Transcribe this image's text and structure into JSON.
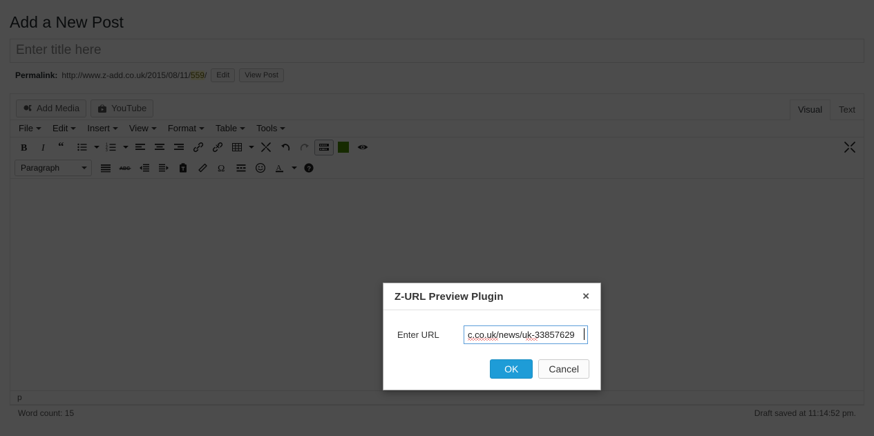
{
  "page": {
    "title": "Add a New Post"
  },
  "post_title": {
    "placeholder": "Enter title here",
    "value": ""
  },
  "permalink": {
    "label": "Permalink:",
    "url_prefix": "http://www.z-add.co.uk/2015/08/11/",
    "slug": "559",
    "url_suffix": "/",
    "edit_label": "Edit",
    "view_label": "View Post"
  },
  "media_bar": {
    "add_media_label": "Add Media",
    "youtube_label": "YouTube",
    "tabs": [
      {
        "label": "Visual",
        "active": true
      },
      {
        "label": "Text",
        "active": false
      }
    ]
  },
  "menubar": {
    "items": [
      {
        "label": "File"
      },
      {
        "label": "Edit"
      },
      {
        "label": "Insert"
      },
      {
        "label": "View"
      },
      {
        "label": "Format"
      },
      {
        "label": "Table"
      },
      {
        "label": "Tools"
      }
    ]
  },
  "toolbar_row1": {
    "buttons": [
      {
        "name": "bold",
        "glyph": "B"
      },
      {
        "name": "italic",
        "glyph": "I"
      },
      {
        "name": "blockquote",
        "glyph": "“"
      },
      {
        "name": "bullet-list",
        "glyph": "list"
      },
      {
        "name": "numbered-list",
        "glyph": "numlist"
      },
      {
        "name": "align-left",
        "glyph": "alignleft"
      },
      {
        "name": "align-center",
        "glyph": "aligncenter"
      },
      {
        "name": "align-right",
        "glyph": "alignright"
      },
      {
        "name": "link",
        "glyph": "link"
      },
      {
        "name": "unlink",
        "glyph": "unlink"
      },
      {
        "name": "table",
        "glyph": "table"
      },
      {
        "name": "read-more",
        "glyph": "readmore"
      },
      {
        "name": "undo",
        "glyph": "undo"
      },
      {
        "name": "redo",
        "glyph": "redo"
      },
      {
        "name": "toolbar-toggle",
        "glyph": "kitchensink"
      },
      {
        "name": "z-url-preview",
        "glyph": "greenswatch"
      },
      {
        "name": "preview-eye",
        "glyph": "eye"
      },
      {
        "name": "fullscreen",
        "glyph": "fullscreen"
      }
    ]
  },
  "toolbar_row2": {
    "format_select": "Paragraph",
    "buttons": [
      {
        "name": "justify",
        "glyph": "justify"
      },
      {
        "name": "strikethrough",
        "glyph": "strike"
      },
      {
        "name": "outdent",
        "glyph": "outdent"
      },
      {
        "name": "indent",
        "glyph": "indent"
      },
      {
        "name": "paste-as-text",
        "glyph": "paste"
      },
      {
        "name": "clear-formatting",
        "glyph": "eraser"
      },
      {
        "name": "special-character",
        "glyph": "omega"
      },
      {
        "name": "horizontal-rule",
        "glyph": "hr"
      },
      {
        "name": "emoji",
        "glyph": "smiley"
      },
      {
        "name": "text-color",
        "glyph": "textcolor"
      },
      {
        "name": "help",
        "glyph": "help"
      }
    ]
  },
  "editor": {
    "content": "",
    "element_path": "p"
  },
  "post_status": {
    "word_count": "Word count: 15",
    "draft_saved": "Draft saved at 11:14:52 pm."
  },
  "modal": {
    "title": "Z-URL Preview Plugin",
    "close_label": "×",
    "field_label": "Enter URL",
    "input_value": "c.co.uk/news/uk-33857629",
    "input_placeholder": "",
    "ok_label": "OK",
    "cancel_label": "Cancel"
  },
  "colors": {
    "accent_blue": "#1e9cd7",
    "input_focus_border": "#5b9dd9",
    "plugin_green": "#4c8c00",
    "permalink_highlight": "#fffbcc",
    "spellcheck_red": "#e03131",
    "overlay": "rgba(0,0,0,0.70)"
  }
}
